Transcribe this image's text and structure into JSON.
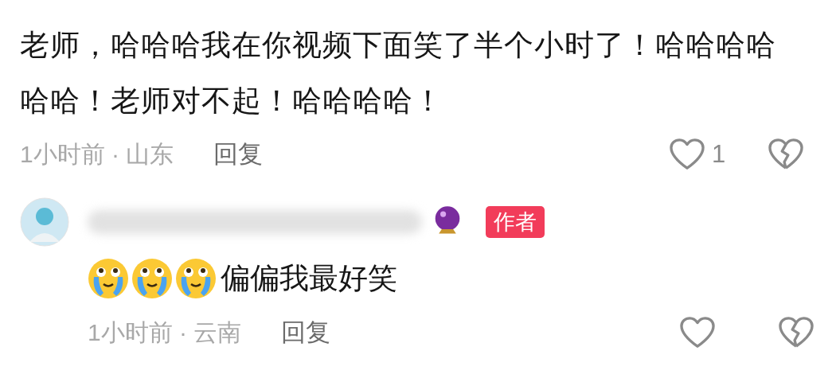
{
  "comment": {
    "text": "老师，哈哈哈我在你视频下面笑了半个小时了！哈哈哈哈哈哈！老师对不起！哈哈哈哈！",
    "meta": "1小时前 · 山东",
    "reply_label": "回复",
    "liked": false,
    "like_count": "1"
  },
  "reply": {
    "badge": "作者",
    "emojis": [
      {
        "kind": "crying"
      },
      {
        "kind": "crying"
      },
      {
        "kind": "crying"
      }
    ],
    "text": "偏偏我最好笑",
    "meta": "1小时前 · 云南",
    "reply_label": "回复",
    "liked": false
  }
}
